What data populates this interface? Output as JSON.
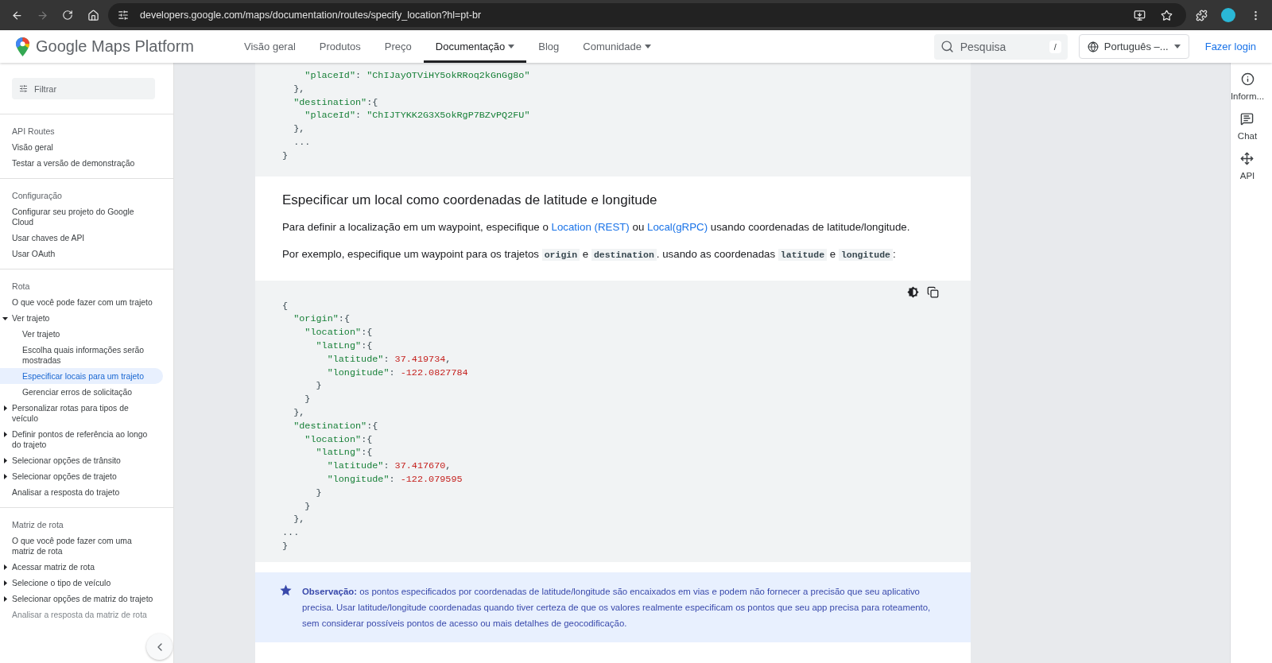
{
  "browser": {
    "url": "developers.google.com/maps/documentation/routes/specify_location?hl=pt-br",
    "forward_disabled": true
  },
  "header": {
    "logo": {
      "brand": "Google",
      "product": "Maps Platform"
    },
    "nav": [
      {
        "label": "Visão geral",
        "selected": false,
        "dropdown": false
      },
      {
        "label": "Produtos",
        "selected": false,
        "dropdown": false
      },
      {
        "label": "Preço",
        "selected": false,
        "dropdown": false
      },
      {
        "label": "Documentação",
        "selected": true,
        "dropdown": true
      },
      {
        "label": "Blog",
        "selected": false,
        "dropdown": false
      },
      {
        "label": "Comunidade",
        "selected": false,
        "dropdown": true
      }
    ],
    "search": {
      "placeholder": "Pesquisa",
      "shortcut": "/"
    },
    "language": "Português –...",
    "login": "Fazer login"
  },
  "sidebar": {
    "filter": {
      "placeholder": "Filtrar"
    },
    "sections": [
      {
        "heading": "API Routes",
        "items": [
          {
            "label": "Visão geral",
            "kind": "link",
            "selected": false
          },
          {
            "label": "Testar a versão de demonstração",
            "kind": "link",
            "selected": false
          }
        ]
      },
      {
        "heading": "Configuração",
        "items": [
          {
            "label": "Configurar seu projeto do Google Cloud",
            "kind": "link",
            "selected": false
          },
          {
            "label": "Usar chaves de API",
            "kind": "link",
            "selected": false
          },
          {
            "label": "Usar OAuth",
            "kind": "link",
            "selected": false
          }
        ]
      },
      {
        "heading": "Rota",
        "items": [
          {
            "label": "O que você pode fazer com um trajeto",
            "kind": "link",
            "selected": false
          },
          {
            "label": "Ver trajeto",
            "kind": "group",
            "expanded": true,
            "selected": false,
            "children": [
              {
                "label": "Ver trajeto",
                "kind": "link",
                "selected": false
              },
              {
                "label": "Escolha quais informações serão mostradas",
                "kind": "link",
                "selected": false
              },
              {
                "label": "Especificar locais para um trajeto",
                "kind": "link",
                "selected": true
              },
              {
                "label": "Gerenciar erros de solicitação",
                "kind": "link",
                "selected": false
              }
            ]
          },
          {
            "label": "Personalizar rotas para tipos de veículo",
            "kind": "group",
            "expanded": false,
            "selected": false
          },
          {
            "label": "Definir pontos de referência ao longo do trajeto",
            "kind": "group",
            "expanded": false,
            "selected": false
          },
          {
            "label": "Selecionar opções de trânsito",
            "kind": "group",
            "expanded": false,
            "selected": false
          },
          {
            "label": "Selecionar opções de trajeto",
            "kind": "group",
            "expanded": false,
            "selected": false
          },
          {
            "label": "Analisar a resposta do trajeto",
            "kind": "link",
            "selected": false
          }
        ]
      },
      {
        "heading": "Matriz de rota",
        "items": [
          {
            "label": "O que você pode fazer com uma matriz de rota",
            "kind": "link",
            "selected": false
          },
          {
            "label": "Acessar matriz de rota",
            "kind": "group",
            "expanded": false,
            "selected": false
          },
          {
            "label": "Selecione o tipo de veículo",
            "kind": "group",
            "expanded": false,
            "selected": false
          },
          {
            "label": "Selecionar opções de matriz do trajeto",
            "kind": "group",
            "expanded": false,
            "selected": false
          },
          {
            "label": "Analisar a resposta da matriz de rota",
            "kind": "link",
            "selected": false,
            "disabled": true
          }
        ]
      }
    ]
  },
  "content": {
    "code_top": [
      [
        {
          "text": "    \"placeId\"",
          "kind": "string"
        },
        {
          "text": ": ",
          "kind": "punct"
        },
        {
          "text": "\"ChIJayOTViHY5okRRoq2kGnGg8o\"",
          "kind": "string"
        }
      ],
      [
        {
          "text": "  },",
          "kind": "punct"
        }
      ],
      [
        {
          "text": "  \"destination\"",
          "kind": "string"
        },
        {
          "text": ":{",
          "kind": "punct"
        }
      ],
      [
        {
          "text": "    \"placeId\"",
          "kind": "string"
        },
        {
          "text": ": ",
          "kind": "punct"
        },
        {
          "text": "\"ChIJTYKK2G3X5okRgP7BZvPQ2FU\"",
          "kind": "string"
        }
      ],
      [
        {
          "text": "  },",
          "kind": "punct"
        }
      ],
      [
        {
          "text": "  ...",
          "kind": "punct"
        }
      ],
      [
        {
          "text": "}",
          "kind": "punct"
        }
      ]
    ],
    "heading": "Especificar um local como coordenadas de latitude e longitude",
    "paragraphs": [
      [
        {
          "text": "Para definir a localização em um waypoint, especifique o ",
          "kind": "text"
        },
        {
          "text": "Location (REST)",
          "kind": "link"
        },
        {
          "text": " ou ",
          "kind": "text"
        },
        {
          "text": "Local(gRPC)",
          "kind": "link"
        },
        {
          "text": " usando coordenadas de latitude/longitude.",
          "kind": "text"
        }
      ],
      [
        {
          "text": "Por exemplo, especifique um waypoint para os trajetos ",
          "kind": "text"
        },
        {
          "text": "origin",
          "kind": "code"
        },
        {
          "text": " e ",
          "kind": "text"
        },
        {
          "text": "destination",
          "kind": "code"
        },
        {
          "text": ". usando as coordenadas ",
          "kind": "text"
        },
        {
          "text": "latitude",
          "kind": "code"
        },
        {
          "text": " e ",
          "kind": "text"
        },
        {
          "text": "longitude",
          "kind": "code"
        },
        {
          "text": ":",
          "kind": "text"
        }
      ]
    ],
    "code": [
      [
        {
          "text": "{",
          "kind": "punct"
        }
      ],
      [
        {
          "text": "  \"origin\"",
          "kind": "string"
        },
        {
          "text": ":{",
          "kind": "punct"
        }
      ],
      [
        {
          "text": "    \"location\"",
          "kind": "string"
        },
        {
          "text": ":{",
          "kind": "punct"
        }
      ],
      [
        {
          "text": "      \"latLng\"",
          "kind": "string"
        },
        {
          "text": ":{",
          "kind": "punct"
        }
      ],
      [
        {
          "text": "        \"latitude\"",
          "kind": "string"
        },
        {
          "text": ": ",
          "kind": "punct"
        },
        {
          "text": "37.419734",
          "kind": "number"
        },
        {
          "text": ",",
          "kind": "punct"
        }
      ],
      [
        {
          "text": "        \"longitude\"",
          "kind": "string"
        },
        {
          "text": ": ",
          "kind": "punct"
        },
        {
          "text": "-122.0827784",
          "kind": "number"
        }
      ],
      [
        {
          "text": "      }",
          "kind": "punct"
        }
      ],
      [
        {
          "text": "    }",
          "kind": "punct"
        }
      ],
      [
        {
          "text": "  },",
          "kind": "punct"
        }
      ],
      [
        {
          "text": "  \"destination\"",
          "kind": "string"
        },
        {
          "text": ":{",
          "kind": "punct"
        }
      ],
      [
        {
          "text": "    \"location\"",
          "kind": "string"
        },
        {
          "text": ":{",
          "kind": "punct"
        }
      ],
      [
        {
          "text": "      \"latLng\"",
          "kind": "string"
        },
        {
          "text": ":{",
          "kind": "punct"
        }
      ],
      [
        {
          "text": "        \"latitude\"",
          "kind": "string"
        },
        {
          "text": ": ",
          "kind": "punct"
        },
        {
          "text": "37.417670",
          "kind": "number"
        },
        {
          "text": ",",
          "kind": "punct"
        }
      ],
      [
        {
          "text": "        \"longitude\"",
          "kind": "string"
        },
        {
          "text": ": ",
          "kind": "punct"
        },
        {
          "text": "-122.079595",
          "kind": "number"
        }
      ],
      [
        {
          "text": "      }",
          "kind": "punct"
        }
      ],
      [
        {
          "text": "    }",
          "kind": "punct"
        }
      ],
      [
        {
          "text": "  },",
          "kind": "punct"
        }
      ],
      [
        {
          "text": "...",
          "kind": "punct"
        }
      ],
      [
        {
          "text": "}",
          "kind": "punct"
        }
      ]
    ],
    "note": "**Observação:** os pontos especificados por coordenadas de latitude/longitude são encaixados em vias e podem não fornecer a precisão que seu aplicativo precisa. Usar latitude/longitude coordenadas quando tiver certeza de que os valores realmente especificam os pontos que seu app precisa para roteamento, sem considerar possíveis pontos de acesso ou mais detalhes de geocodificação."
  },
  "rail": [
    {
      "label": "Inform...",
      "kind": "info"
    },
    {
      "label": "Chat",
      "kind": "chat"
    },
    {
      "label": "API",
      "kind": "api"
    }
  ]
}
